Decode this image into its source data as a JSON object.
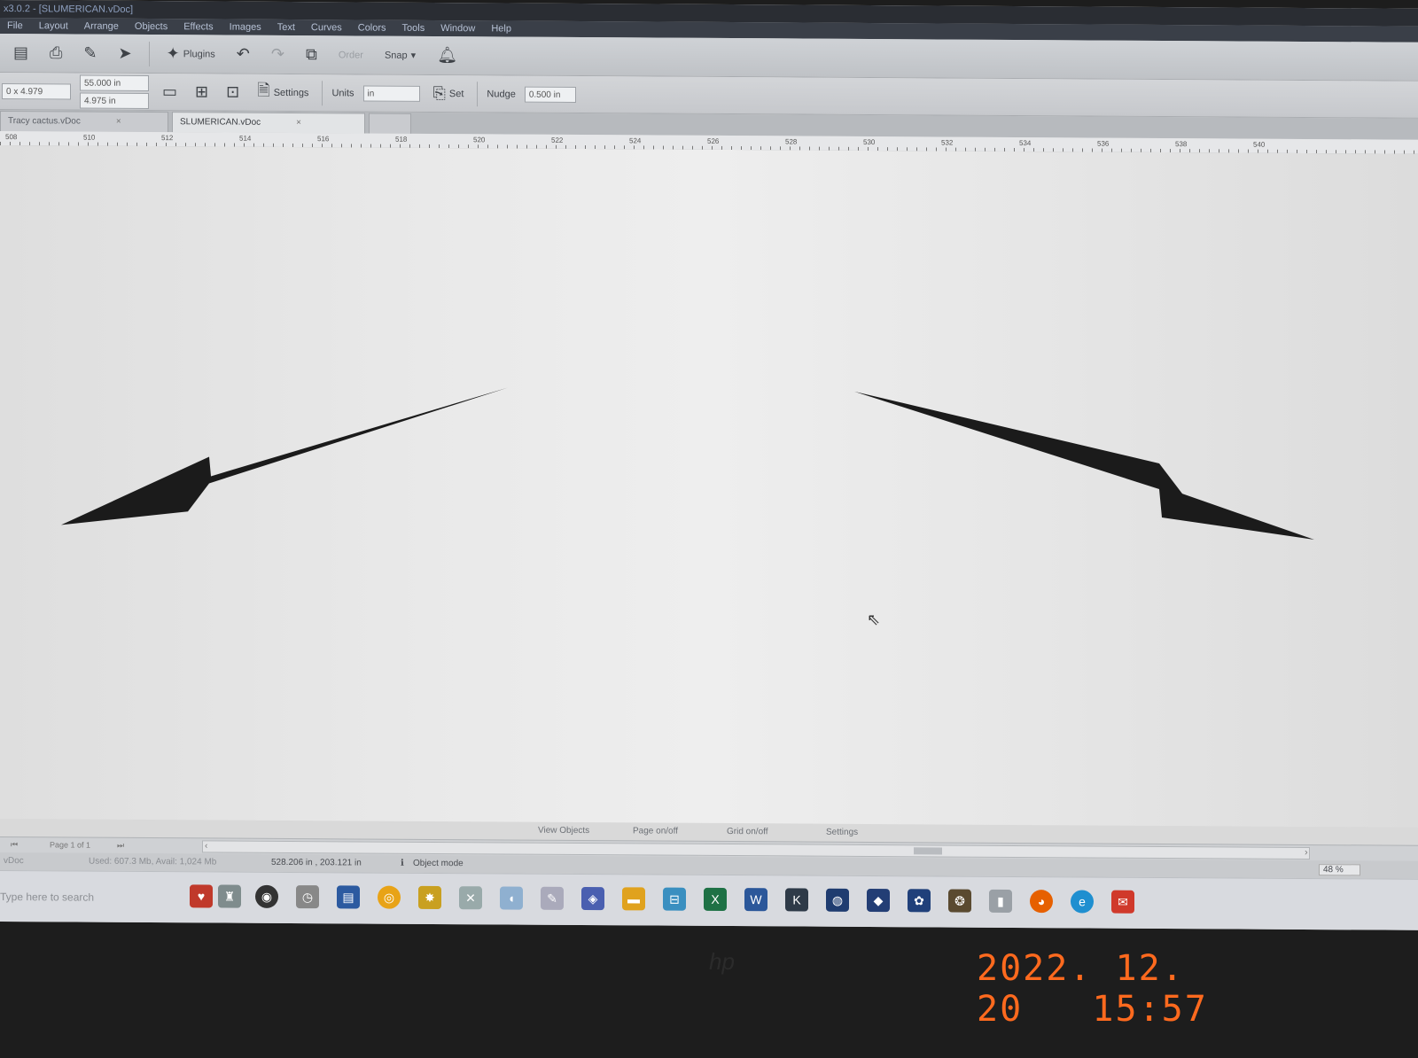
{
  "window": {
    "title": "x3.0.2 - [SLUMERICAN.vDoc]"
  },
  "menu": [
    "File",
    "Layout",
    "Arrange",
    "Objects",
    "Effects",
    "Images",
    "Text",
    "Curves",
    "Colors",
    "Tools",
    "Window",
    "Help"
  ],
  "toolbar": {
    "plugins_label": "Plugins",
    "order_label": "Order",
    "snap_label": "Snap"
  },
  "props": {
    "pos": "0 x 4.979",
    "width": "55.000 in",
    "height": "4.975 in",
    "settings_label": "Settings",
    "units_label": "Units",
    "units_value": "in",
    "set_label": "Set",
    "nudge_label": "Nudge",
    "nudge_value": "0.500 in"
  },
  "tabs": [
    {
      "label": "Tracy cactus.vDoc"
    },
    {
      "label": "SLUMERICAN.vDoc"
    }
  ],
  "ruler": [
    "508",
    "510",
    "512",
    "514",
    "516",
    "518",
    "520",
    "522",
    "524",
    "526",
    "528",
    "530",
    "532",
    "534",
    "536",
    "538",
    "540"
  ],
  "quick_actions": [
    "View Objects",
    "Page on/off",
    "Grid on/off",
    "Settings"
  ],
  "page_nav": {
    "label": "Page 1 of 1"
  },
  "status": {
    "doc": "vDoc",
    "memory": "Used: 607.3 Mb, Avail: 1,024 Mb",
    "coords": "528.206 in , 203.121 in",
    "mode": "Object mode",
    "zoom": "48 %"
  },
  "taskbar": {
    "search_placeholder": "Type here to search"
  },
  "photo": {
    "date": "2022. 12. 20",
    "time": "15:57"
  },
  "colors": {
    "datestamp": "#ff6a1e",
    "bolt": "#1b1b1b"
  }
}
